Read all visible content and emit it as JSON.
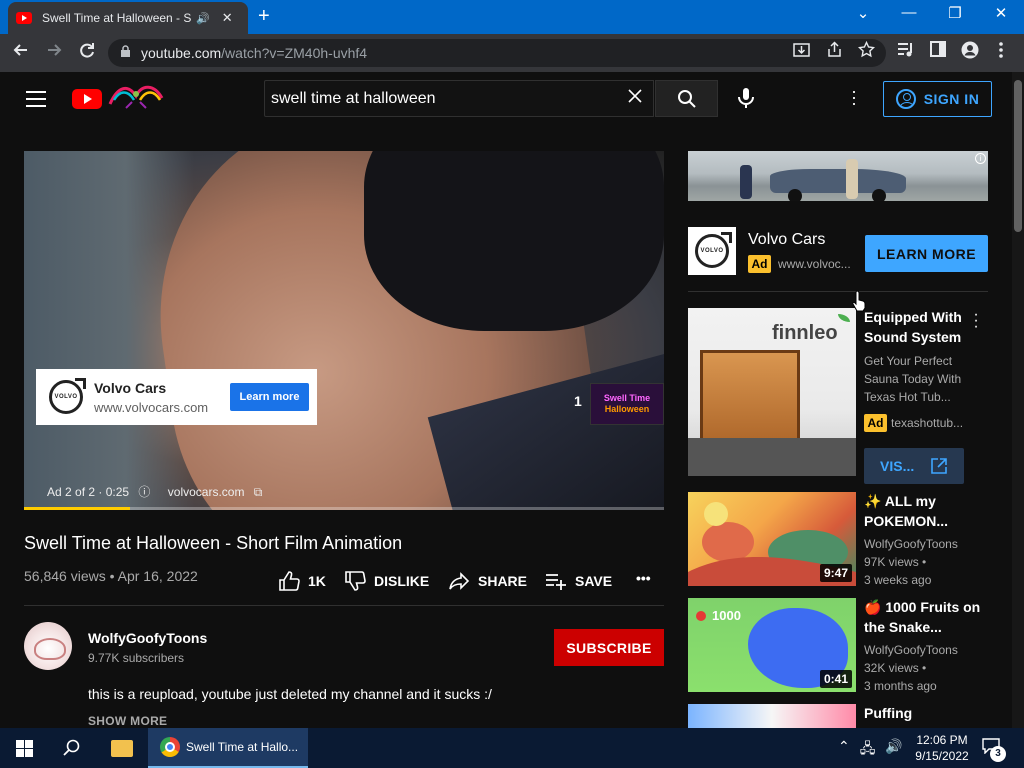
{
  "browser": {
    "tab_title": "Swell Time at Halloween - Sh",
    "tab_close": "✕",
    "tab_sound": "🔊",
    "new_tab": "+",
    "window_controls": {
      "chevron": "⌄",
      "minimize": "—",
      "restore": "❐",
      "close": "✕"
    },
    "url_host": "youtube.com",
    "url_path": "/watch?v=ZM40h-uvhf4"
  },
  "youtube": {
    "search_query": "swell time at halloween",
    "sign_in_label": "SIGN IN",
    "video": {
      "ad_card_name": "Volvo Cars",
      "ad_card_url": "www.volvocars.com",
      "ad_card_button": "Learn more",
      "ad_count": "1",
      "ad_thumb_line1": "Swell Time",
      "ad_thumb_line2": "Halloween",
      "ad_info": "Ad 2 of 2 · 0:25",
      "ad_domain": "volvocars.com",
      "ad_progress": 0.166
    },
    "title": "Swell Time at Halloween - Short Film Animation",
    "views_date": "56,846 views • Apr 16, 2022",
    "actions": {
      "like": "1K",
      "dislike": "DISLIKE",
      "share": "SHARE",
      "save": "SAVE",
      "more": "•••"
    },
    "channel": {
      "name": "WolfyGoofyToons",
      "subscribers": "9.77K subscribers",
      "subscribe_label": "SUBSCRIBE"
    },
    "description": "this is a reupload, youtube just deleted my channel and it sucks :/",
    "show_more": "SHOW MORE",
    "sidebar": {
      "ad": {
        "name": "Volvo Cars",
        "badge": "Ad",
        "url": "www.volvoc...",
        "button": "LEARN MORE"
      },
      "promoted": {
        "title": "Equipped With Sound System",
        "desc": "Get Your Perfect Sauna Today With Texas Hot Tub...",
        "badge": "Ad",
        "url": "texashottub...",
        "button": "VIS...",
        "thumb_brand": "finnleo"
      },
      "videos": [
        {
          "title": "✨ ALL my POKEMON...",
          "channel": "WolfyGoofyToons",
          "views": "97K views •",
          "age": "3 weeks ago",
          "duration": "9:47"
        },
        {
          "title": "🍎 1000 Fruits on the Snake...",
          "channel": "WolfyGoofyToons",
          "views": "32K views •",
          "age": "3 months ago",
          "duration": "0:41",
          "thumb_text": "1000"
        },
        {
          "title": "Puffing"
        }
      ]
    }
  },
  "taskbar": {
    "chrome_title": "Swell Time at Hallo...",
    "time": "12:06 PM",
    "date": "9/15/2022",
    "notifications": "3"
  },
  "colors": {
    "accent_blue": "#3ea6ff",
    "subscribe_red": "#cc0000",
    "ad_yellow": "#fbc02d",
    "youtube_red": "#ff0000"
  }
}
